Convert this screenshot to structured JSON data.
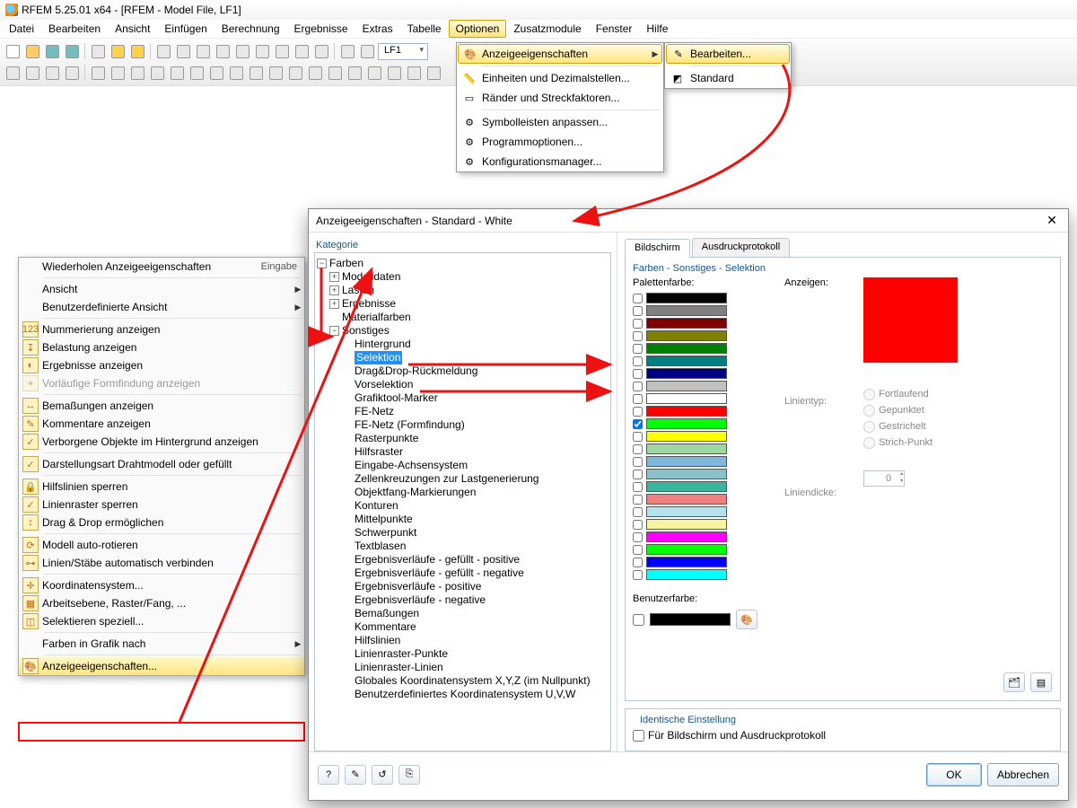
{
  "titlebar": "RFEM 5.25.01 x64 - [RFEM - Model File, LF1]",
  "menubar": [
    "Datei",
    "Bearbeiten",
    "Ansicht",
    "Einfügen",
    "Berechnung",
    "Ergebnisse",
    "Extras",
    "Tabelle",
    "Optionen",
    "Zusatzmodule",
    "Fenster",
    "Hilfe"
  ],
  "toolbar": {
    "combo_lf": "LF1"
  },
  "options_menu": {
    "display_properties": "Anzeigeeigenschaften",
    "units": "Einheiten und Dezimalstellen...",
    "margins": "Ränder und Streckfaktoren...",
    "toolbars": "Symbolleisten anpassen...",
    "progopts": "Programmoptionen...",
    "config": "Konfigurationsmanager...",
    "edit": "Bearbeiten...",
    "standard": "Standard"
  },
  "ctx": {
    "repeat": "Wiederholen Anzeigeeigenschaften",
    "repeat_r": "Eingabe",
    "view": "Ansicht",
    "custom_view": "Benutzerdefinierte Ansicht",
    "numbering": "Nummerierung anzeigen",
    "load": "Belastung anzeigen",
    "results": "Ergebnisse anzeigen",
    "formfind": "Vorläufige Formfindung anzeigen",
    "dims": "Bemaßungen anzeigen",
    "comments": "Kommentare anzeigen",
    "hidden": "Verborgene Objekte im Hintergrund anzeigen",
    "wire": "Darstellungsart Drahtmodell oder gefüllt",
    "lockgl": "Hilfslinien sperren",
    "lockgrid": "Linienraster sperren",
    "dragdrop": "Drag & Drop ermöglichen",
    "autorot": "Modell auto-rotieren",
    "autoconn": "Linien/Stäbe automatisch verbinden",
    "coord": "Koordinatensystem...",
    "workplane": "Arbeitsebene, Raster/Fang, ...",
    "selspec": "Selektieren speziell...",
    "colorsby": "Farben in Grafik nach",
    "displayprops": "Anzeigeeigenschaften..."
  },
  "dialog": {
    "title": "Anzeigeeigenschaften - Standard - White",
    "cat_label": "Kategorie",
    "tree": {
      "root": "Farben",
      "l1": [
        "Modelldaten",
        "Lasten",
        "Ergebnisse",
        "Materialfarben",
        "Sonstiges"
      ],
      "sonst": [
        "Hintergrund",
        "Selektion",
        "Drag&Drop-Rückmeldung",
        "Vorselektion",
        "Grafiktool-Marker",
        "FE-Netz",
        "FE-Netz (Formfindung)",
        "Rasterpunkte",
        "Hilfsraster",
        "Eingabe-Achsensystem",
        "Zellenkreuzungen zur Lastgenerierung",
        "Objektfang-Markierungen",
        "Konturen",
        "Mittelpunkte",
        "Schwerpunkt",
        "Textblasen",
        "Ergebnisverläufe - gefüllt - positive",
        "Ergebnisverläufe - gefüllt - negative",
        "Ergebnisverläufe - positive",
        "Ergebnisverläufe - negative",
        "Bemaßungen",
        "Kommentare",
        "Hilfslinien",
        "Linienraster-Punkte",
        "Linienraster-Linien",
        "Globales Koordinatensystem X,Y,Z (im Nullpunkt)",
        "Benutzerdefiniertes Koordinatensystem U,V,W"
      ]
    },
    "tabs": [
      "Bildschirm",
      "Ausdruckprotokoll"
    ],
    "crumb": "Farben - Sonstiges - Selektion",
    "labels": {
      "palette": "Palettenfarbe:",
      "show": "Anzeigen:",
      "linetype": "Linientyp:",
      "linew": "Liniendicke:",
      "user": "Benutzerfarbe:",
      "lt1": "Fortlaufend",
      "lt2": "Gepunktet",
      "lt3": "Gestrichelt",
      "lt4": "Strich-Punkt",
      "lw_val": "0"
    },
    "palette": [
      "#000000",
      "#808080",
      "#800000",
      "#808000",
      "#008000",
      "#008080",
      "#000080",
      "#c0c0c0",
      "#ffffff",
      "#ff0000",
      "#00ff00",
      "#ffff00",
      "#9fd7a2",
      "#7fb7df",
      "#89c3c9",
      "#39b59e",
      "#f08080",
      "#b4e2ee",
      "#f7f4a1",
      "#ff00ff",
      "#00ff00",
      "#0000ff",
      "#00ffff"
    ],
    "x_checked_index": 10,
    "ident": {
      "title": "Identische Einstellung",
      "chk": "Für Bildschirm und Ausdruckprotokoll"
    },
    "buttons": {
      "ok": "OK",
      "cancel": "Abbrechen"
    }
  }
}
